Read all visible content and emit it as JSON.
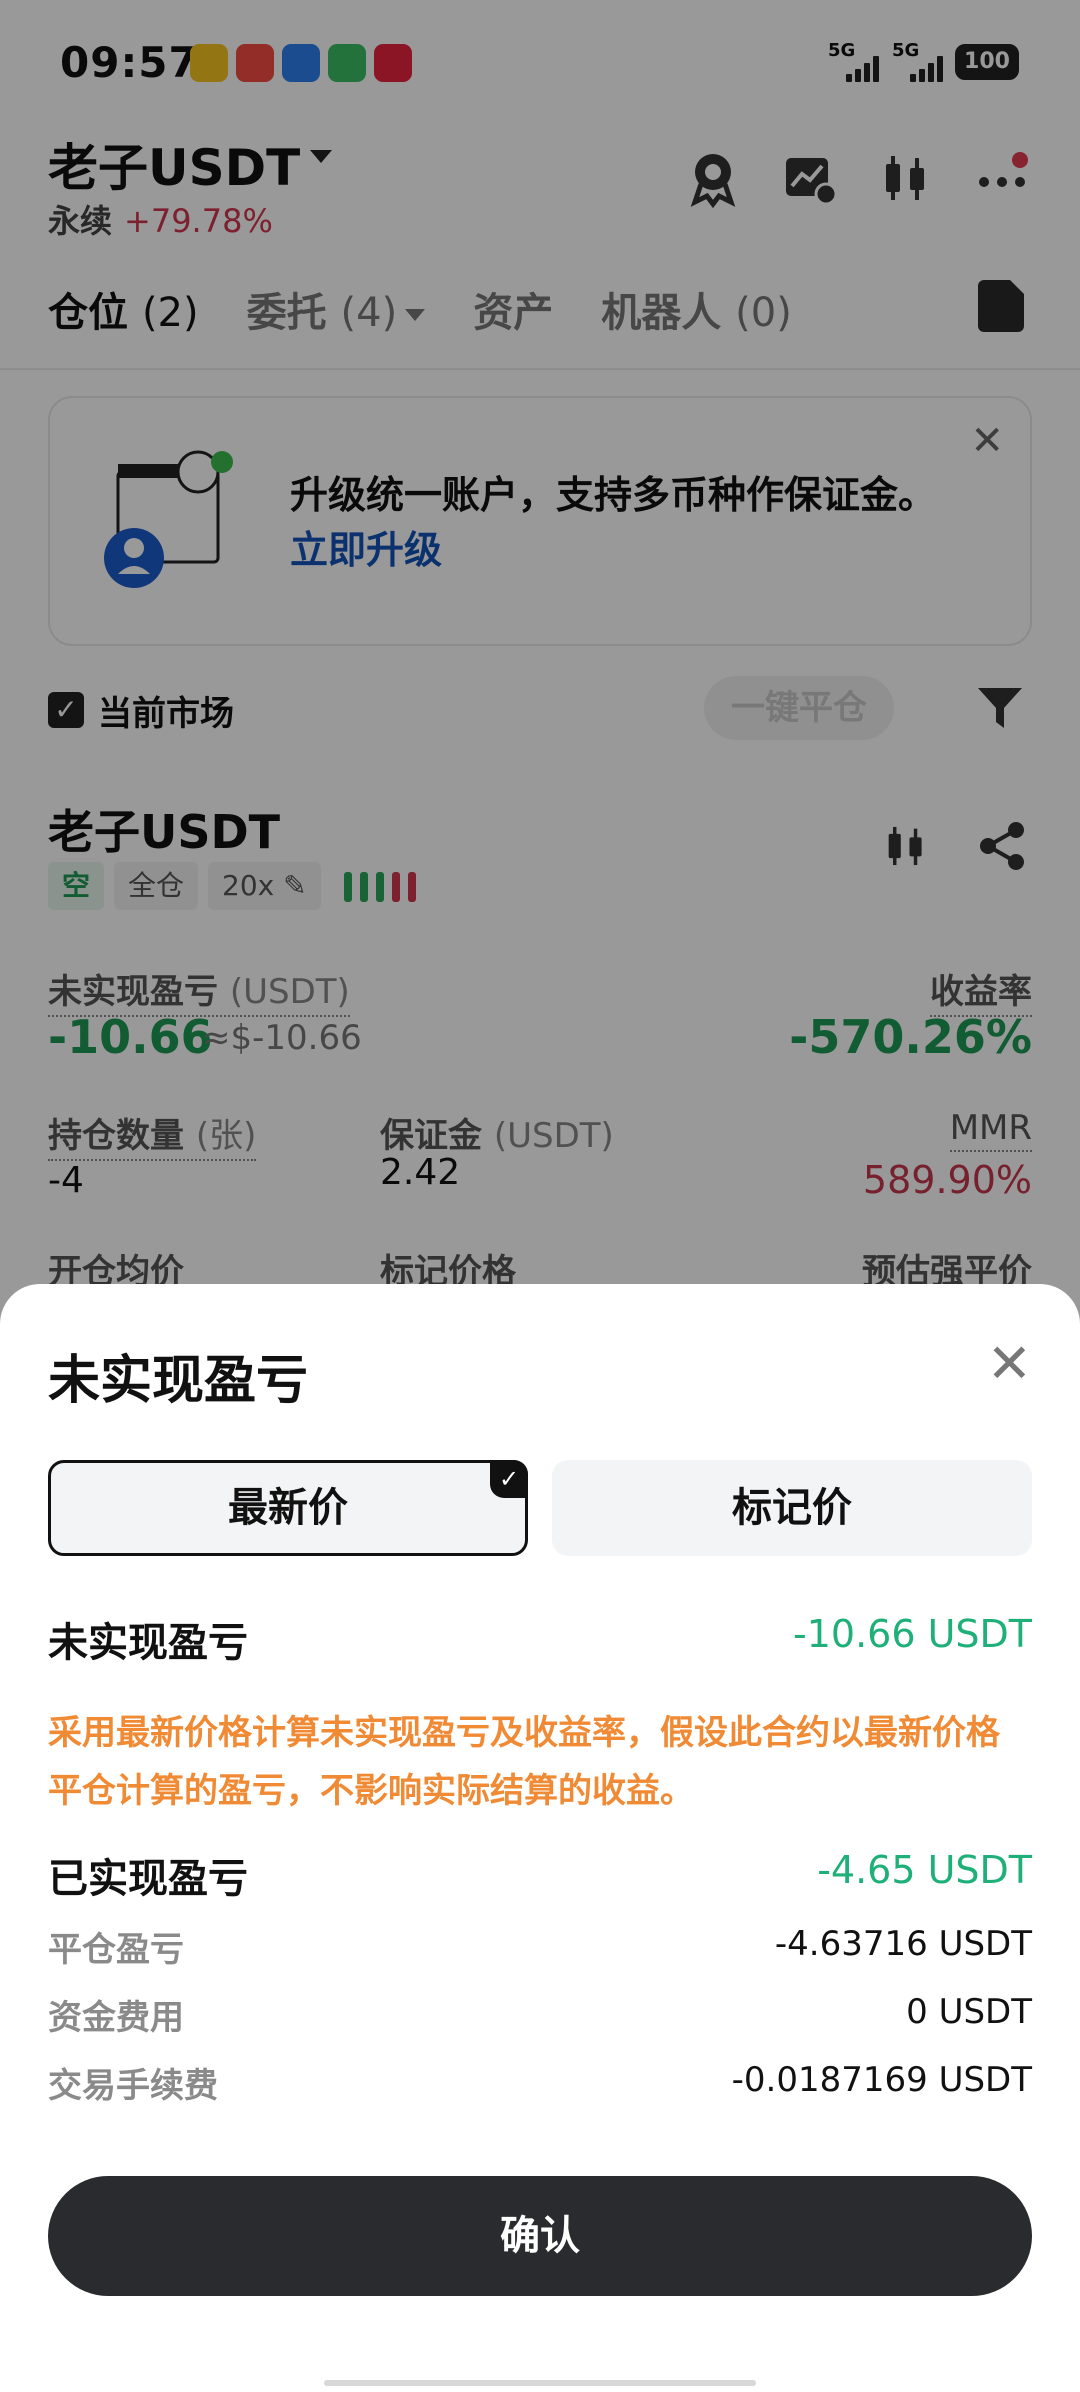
{
  "status_bar": {
    "time": "09:57",
    "net1": "5G",
    "net2": "5G",
    "battery": "100"
  },
  "header": {
    "title": "老子USDT",
    "perpetual": "永续",
    "change": "+79.78%"
  },
  "tabs": [
    {
      "label": "仓位",
      "count": "(2)"
    },
    {
      "label": "委托",
      "count": "(4)"
    },
    {
      "label": "资产",
      "count": ""
    },
    {
      "label": "机器人",
      "count": "(0)"
    }
  ],
  "banner": {
    "text": "升级统一账户，支持多币种作保证金。",
    "link": "立即升级"
  },
  "filter": {
    "current_market": "当前市场",
    "close_all": "一键平仓"
  },
  "position": {
    "name": "老子USDT",
    "side_tag": "空",
    "margin_mode": "全仓",
    "leverage": "20x",
    "unrealized_label": "未实现盈亏",
    "unrealized_unit": "(USDT)",
    "unrealized_value": "-10.66",
    "unrealized_approx": "≈$-10.66",
    "roe_label": "收益率",
    "roe_value": "-570.26%",
    "qty_label": "持仓数量",
    "qty_unit": "(张)",
    "qty_value": "-4",
    "margin_label": "保证金",
    "margin_unit": "(USDT)",
    "margin_value": "2.42",
    "mmr_label": "MMR",
    "mmr_value": "589.90%",
    "entry_label": "开仓均价",
    "mark_label": "标记价格",
    "liq_label": "预估强平价"
  },
  "sheet": {
    "title": "未实现盈亏",
    "tab_latest": "最新价",
    "tab_mark": "标记价",
    "unrealized_label": "未实现盈亏",
    "unrealized_value": "-10.66 USDT",
    "note": "采用最新价格计算未实现盈亏及收益率，假设此合约以最新价格平仓计算的盈亏，不影响实际结算的收益。",
    "realized_label": "已实现盈亏",
    "realized_value": "-4.65 USDT",
    "close_pnl_label": "平仓盈亏",
    "close_pnl_value": "-4.63716 USDT",
    "funding_label": "资金费用",
    "funding_value": "0 USDT",
    "fee_label": "交易手续费",
    "fee_value": "-0.0187169 USDT",
    "confirm": "确认"
  },
  "colors": {
    "green": "#1fb07a",
    "red": "#c7364d",
    "orange": "#f08a34",
    "blue": "#1354b8"
  },
  "icons": [
    "badge-icon",
    "chart-icon",
    "candlestick-icon",
    "more-icon",
    "document-icon",
    "filter-icon",
    "share-icon",
    "close-icon",
    "check-icon"
  ]
}
